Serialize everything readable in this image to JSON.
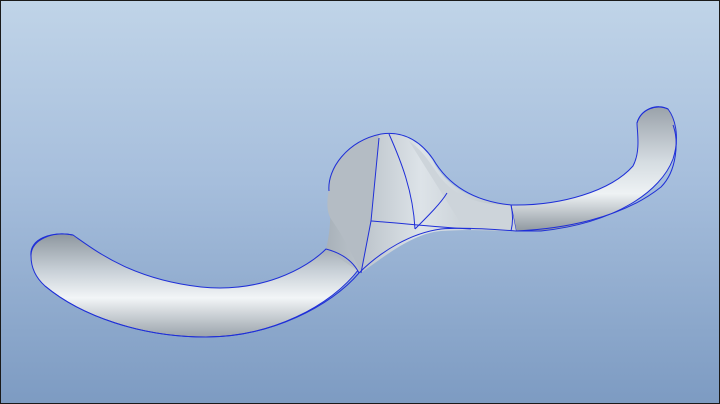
{
  "viewport": {
    "background_top": "#c0d4e8",
    "background_bottom": "#7d9bc2",
    "edge_color": "#1f2fd8",
    "model_color": "#c9d1d8"
  }
}
